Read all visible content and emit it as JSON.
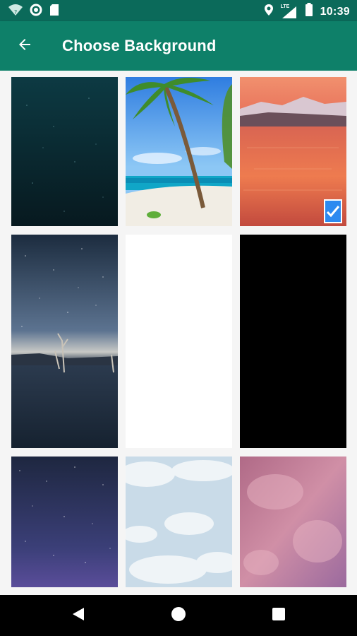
{
  "status_bar": {
    "time": "10:39",
    "network_label": "LTE",
    "icons": [
      "wifi-icon",
      "circle-icon",
      "sd-card-icon",
      "location-icon",
      "signal-icon",
      "battery-icon"
    ]
  },
  "app_bar": {
    "title": "Choose Background",
    "back_icon": "arrow-back-icon",
    "color": "#0e8069"
  },
  "backgrounds": [
    {
      "name": "dark-teal-stars",
      "selected": false
    },
    {
      "name": "palm-beach",
      "selected": false
    },
    {
      "name": "sunset-lake-mountains",
      "selected": true
    },
    {
      "name": "starry-night-dead-trees",
      "selected": false
    },
    {
      "name": "plain-white",
      "selected": false
    },
    {
      "name": "plain-black",
      "selected": false
    },
    {
      "name": "starfield-purple",
      "selected": false
    },
    {
      "name": "cloudy-sky",
      "selected": false
    },
    {
      "name": "pink-clouds",
      "selected": false
    }
  ],
  "selection_indicator": {
    "icon": "check-icon",
    "color": "#2d8af0"
  },
  "nav_bar": {
    "icons": [
      "back-triangle-icon",
      "home-circle-icon",
      "recents-square-icon"
    ]
  }
}
